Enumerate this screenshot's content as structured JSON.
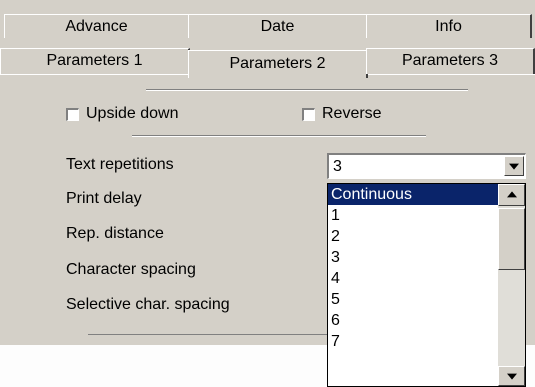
{
  "tabs": {
    "row_back": [
      {
        "label": "Advance"
      },
      {
        "label": "Date"
      },
      {
        "label": "Info"
      }
    ],
    "row_front": [
      {
        "label": "Parameters 1"
      },
      {
        "label": "Parameters 2",
        "active": true
      },
      {
        "label": "Parameters 3"
      }
    ]
  },
  "checkboxes": {
    "upside_down": {
      "label": "Upside down",
      "checked": false
    },
    "reverse": {
      "label": "Reverse",
      "checked": false
    }
  },
  "params": [
    {
      "label": "Text repetitions"
    },
    {
      "label": "Print delay"
    },
    {
      "label": "Rep. distance"
    },
    {
      "label": "Character spacing"
    },
    {
      "label": "Selective char. spacing"
    }
  ],
  "combo": {
    "value": "3",
    "options": [
      "Continuous",
      "1",
      "2",
      "3",
      "4",
      "5",
      "6",
      "7"
    ],
    "highlighted": "Continuous"
  },
  "colors": {
    "face": "#d4d0c8",
    "selection": "#0a246a",
    "selection_text": "#ffffff"
  }
}
